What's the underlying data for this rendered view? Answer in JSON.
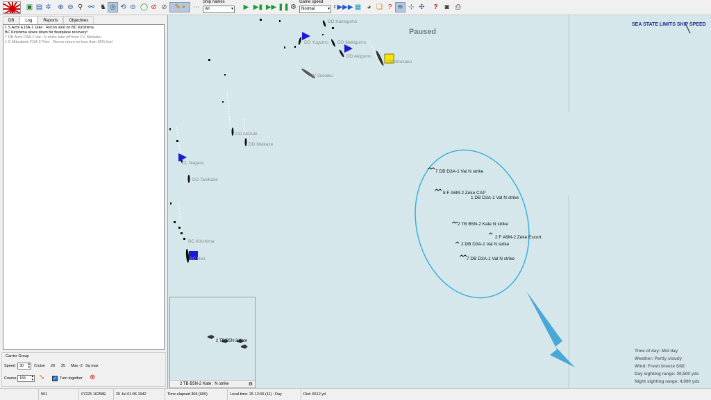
{
  "toolbar": {
    "ship_names_label": "Ship names",
    "ship_names_value": "All",
    "game_speed_label": "Game speed",
    "game_speed_value": "Normal",
    "icons": [
      "flag-icon",
      "save-icon",
      "open-icon",
      "settings-icon",
      "zoom-in-icon",
      "zoom-out-icon",
      "magnify-icon",
      "link-icon",
      "task-force-icon",
      "ring-icon",
      "circle-arrow-icon",
      "minus-circle-icon",
      "green-circle-icon",
      "red-circle-icon",
      "compass-icon",
      "pencil-icon",
      "dots-icon",
      "play-icon",
      "step-icon",
      "fast-forward-icon",
      "pause-icon",
      "gear-icon",
      "fastest-icon",
      "chart-icon",
      "globe-icon",
      "docs-icon",
      "help-icon",
      "weather-icon",
      "route-icon",
      "network-icon",
      "question-icon",
      "camera-icon",
      "print-icon"
    ]
  },
  "left": {
    "tabs": [
      "DB",
      "Log",
      "Reports",
      "Objectives"
    ],
    "log": [
      "1 S Aichi E13A-1 Jake : Recon land on BC Kirishima",
      "BC Kirishima slows down for floatplane recovery!",
      "7 DB Aichi D3A-1 Val : N strike take off from CV Shokaku",
      "1 S Mitsubishi F1M-2 Pete : Recon return on less than 50% fuel"
    ],
    "carrier": {
      "title": "Carrier Group",
      "speed_label": "Speed",
      "speed_value": "30",
      "cruise_label": "Cruise",
      "cruise_value": "20",
      "v25": "25",
      "max_label": "Max -2",
      "sq_label": "Sq max",
      "course_label": "Course",
      "course_value": "155",
      "turn_label": "Turn together"
    }
  },
  "map": {
    "paused": "Paused",
    "sea_state": "SEA STATE LIMITS SHIP SPEED",
    "ships": {
      "kazegumo": "DD Kazegumo",
      "yugumo": "DD Yugumo",
      "makigumo": "DD Makigumo",
      "akigumo": "DD Akigumo",
      "shokaku": "CV Shokaku",
      "zuikaku": "CV Zuikaku",
      "akizuki": "DD Akizuki",
      "maikaze": "DD Maikaze",
      "nagara": "CL Nagara",
      "tanikaze": "DD Tanikaze",
      "kirishima": "BC Kirishima",
      "hiei": "BC Hiei"
    },
    "strikes": [
      "7 DB D3A-1 Val N strike",
      "8 F A6M-2 Zeke CAP",
      "1 DB D3A-1 Val N strike",
      "2 TB B5N-2 Kate N strike",
      "2 F A6M-2 Zeke Escort",
      "2 DB D3A-1 Val N strike",
      "7 DB D3A-1 Val N strike"
    ],
    "info": {
      "time": "Time of day: Mid day",
      "weather": "Weather: Partly cloudy",
      "wind": "Wind: Fresh breeze  SSE",
      "day_range": "Day sighting range: 30,500 yds",
      "night_range": "Night sighting range: 4,000 yds"
    },
    "minimap": {
      "label": "2 TB B5N-2 Kate",
      "caption": "2 TB B5N-2 Kate : N strike"
    },
    "colors": {
      "sea": "#d5e7ea",
      "flag_blue": "#1a1ad6",
      "flag_yellow": "#f5e600",
      "ellipse": "#3ab0e0"
    }
  },
  "status": {
    "s1": "501",
    "s2": "07225 16258E",
    "s3": "25 Jul 01:06 1942",
    "s4": "Time elapsed 306 (600)",
    "s5": "Local time: 25 12:06 (11) : Day",
    "s6": "Dist: 6612 yd"
  }
}
